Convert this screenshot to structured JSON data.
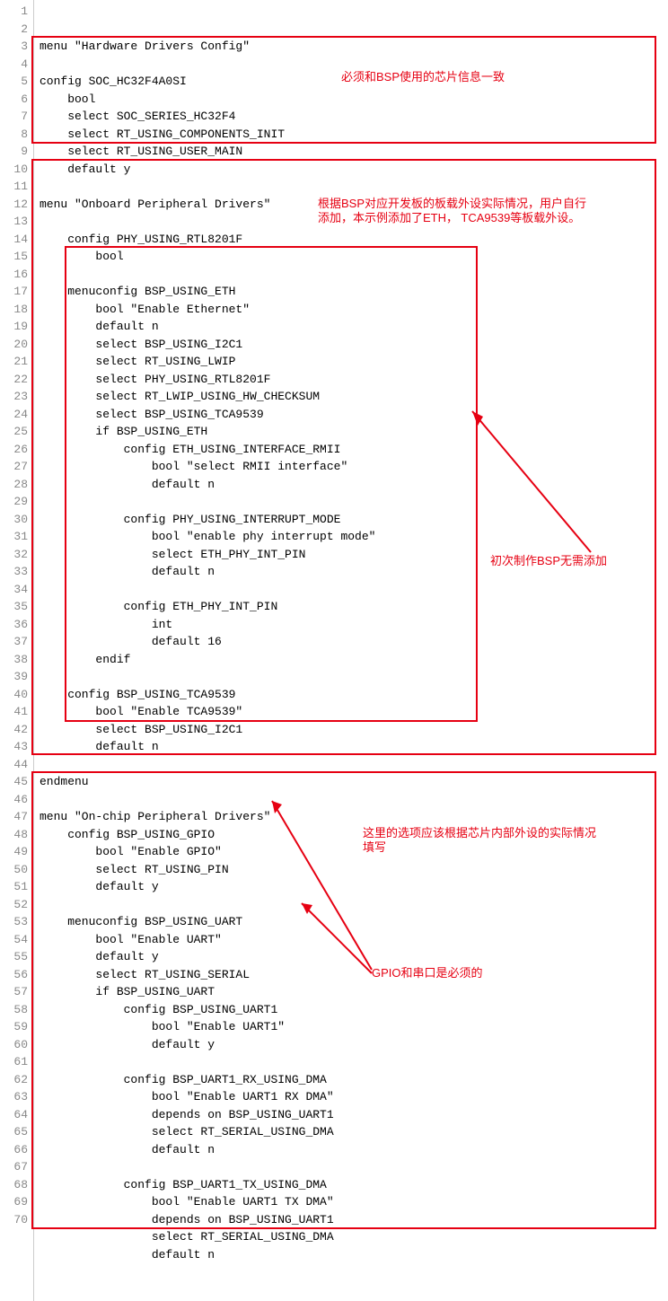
{
  "lines": [
    "menu \"Hardware Drivers Config\"",
    "",
    "config SOC_HC32F4A0SI",
    "    bool",
    "    select SOC_SERIES_HC32F4",
    "    select RT_USING_COMPONENTS_INIT",
    "    select RT_USING_USER_MAIN",
    "    default y",
    "",
    "menu \"Onboard Peripheral Drivers\"",
    "",
    "    config PHY_USING_RTL8201F",
    "        bool",
    "",
    "    menuconfig BSP_USING_ETH",
    "        bool \"Enable Ethernet\"",
    "        default n",
    "        select BSP_USING_I2C1",
    "        select RT_USING_LWIP",
    "        select PHY_USING_RTL8201F",
    "        select RT_LWIP_USING_HW_CHECKSUM",
    "        select BSP_USING_TCA9539",
    "        if BSP_USING_ETH",
    "            config ETH_USING_INTERFACE_RMII",
    "                bool \"select RMII interface\"",
    "                default n",
    "",
    "            config PHY_USING_INTERRUPT_MODE",
    "                bool \"enable phy interrupt mode\"",
    "                select ETH_PHY_INT_PIN",
    "                default n",
    "",
    "            config ETH_PHY_INT_PIN",
    "                int",
    "                default 16",
    "        endif",
    "",
    "    config BSP_USING_TCA9539",
    "        bool \"Enable TCA9539\"",
    "        select BSP_USING_I2C1",
    "        default n",
    "",
    "endmenu",
    "",
    "menu \"On-chip Peripheral Drivers\"",
    "    config BSP_USING_GPIO",
    "        bool \"Enable GPIO\"",
    "        select RT_USING_PIN",
    "        default y",
    "",
    "    menuconfig BSP_USING_UART",
    "        bool \"Enable UART\"",
    "        default y",
    "        select RT_USING_SERIAL",
    "        if BSP_USING_UART",
    "            config BSP_USING_UART1",
    "                bool \"Enable UART1\"",
    "                default y",
    "",
    "            config BSP_UART1_RX_USING_DMA",
    "                bool \"Enable UART1 RX DMA\"",
    "                depends on BSP_USING_UART1",
    "                select RT_SERIAL_USING_DMA",
    "                default n",
    "",
    "            config BSP_UART1_TX_USING_DMA",
    "                bool \"Enable UART1 TX DMA\"",
    "                depends on BSP_USING_UART1",
    "                select RT_SERIAL_USING_DMA",
    "                default n"
  ],
  "annotations": {
    "a1": "必须和BSP使用的芯片信息一致",
    "a2_l1": "根据BSP对应开发板的板载外设实际情况，用户自行",
    "a2_l2": "添加，本示例添加了ETH， TCA9539等板载外设。",
    "a3": "初次制作BSP无需添加",
    "a4_l1": "这里的选项应该根据芯片内部外设的实际情况",
    "a4_l2": "填写",
    "a5": "GPIO和串口是必须的"
  }
}
